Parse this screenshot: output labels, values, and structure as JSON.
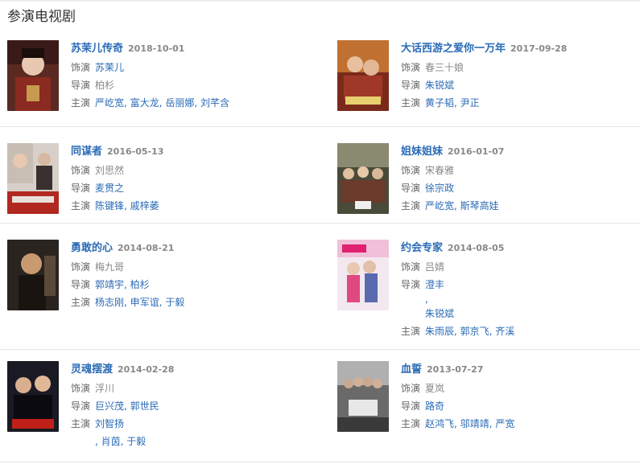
{
  "section_title": "参演电视剧",
  "labels": {
    "role": "饰演",
    "director": "导演",
    "cast": "主演"
  },
  "shows": [
    {
      "title": "苏茉儿传奇",
      "date": "2018-10-01",
      "role": "苏茉儿",
      "directors": [
        "柏杉"
      ],
      "cast": [
        "严屹宽",
        "富大龙",
        "岳丽娜",
        "刘芊含"
      ],
      "role_plain": false,
      "director_plain": true
    },
    {
      "title": "大话西游之爱你一万年",
      "date": "2017-09-28",
      "role": "春三十娘",
      "directors": [
        "朱锐斌"
      ],
      "cast": [
        "黄子韬",
        "尹正"
      ],
      "role_plain": true,
      "director_plain": false
    },
    {
      "title": "同谋者",
      "date": "2016-05-13",
      "role": "刘思然",
      "directors": [
        "麦贯之"
      ],
      "cast": [
        "陈键锋",
        "戚梓萎"
      ],
      "role_plain": true,
      "director_plain": false
    },
    {
      "title": "姐妹姐妹",
      "date": "2016-01-07",
      "role": "宋春雅",
      "directors": [
        "徐宗政"
      ],
      "cast": [
        "严屹宽",
        "斯琴高娃"
      ],
      "role_plain": true,
      "director_plain": false
    },
    {
      "title": "勇敢的心",
      "date": "2014-08-21",
      "role": "梅九哥",
      "directors": [
        "郭靖宇",
        "柏杉"
      ],
      "cast": [
        "杨志刚",
        "申军谊",
        "于毅"
      ],
      "role_plain": true,
      "director_plain": false
    },
    {
      "title": "约会专家",
      "date": "2014-08-05",
      "role": "吕婧",
      "directors": [
        "澄丰",
        ",",
        "朱锐斌"
      ],
      "cast": [
        "朱雨辰",
        "郭京飞",
        "齐溪"
      ],
      "role_plain": true,
      "director_plain": false
    },
    {
      "title": "灵魂摆渡",
      "date": "2014-02-28",
      "role": "浮川",
      "directors": [
        "巨兴茂",
        "郭世民"
      ],
      "cast": [
        "刘智扬",
        "肖茵",
        "于毅"
      ],
      "role_plain": true,
      "director_plain": false
    },
    {
      "title": "血誓",
      "date": "2013-07-27",
      "role": "夏岚",
      "directors": [
        "路奇"
      ],
      "cast": [
        "赵鸿飞",
        "邬靖靖",
        "严宽"
      ],
      "role_plain": true,
      "director_plain": false
    }
  ],
  "colors": {
    "link": "#2a6bb5",
    "date": "#888888",
    "divider": "#e5e5e5"
  }
}
